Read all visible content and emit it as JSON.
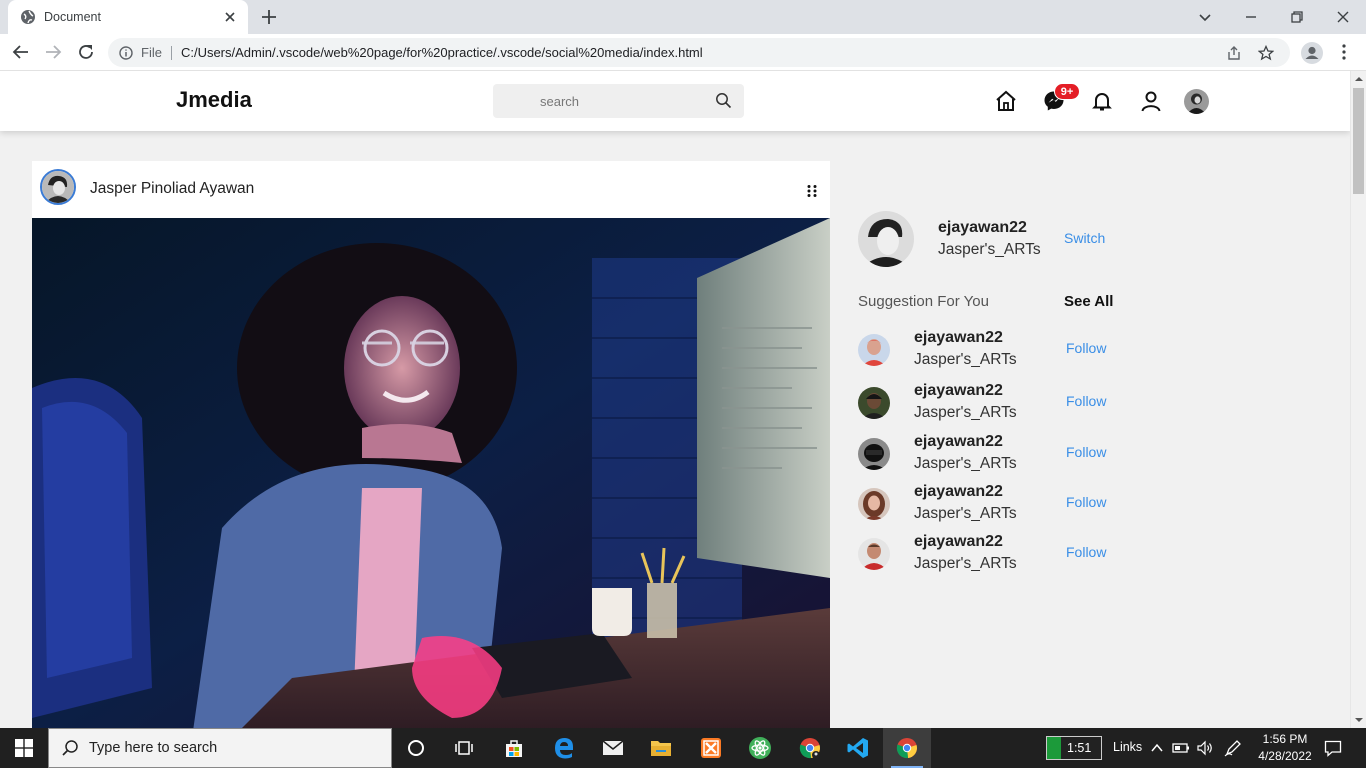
{
  "browser": {
    "tab_title": "Document",
    "url_scheme_label": "File",
    "url": "C:/Users/Admin/.vscode/web%20page/for%20practice/.vscode/social%20media/index.html"
  },
  "app": {
    "logo": "Jmedia",
    "search_placeholder": "search",
    "messages_badge": "9+"
  },
  "post": {
    "author": "Jasper Pinoliad Ayawan"
  },
  "sidebar": {
    "profile": {
      "username": "ejayawan22",
      "subtitle": "Jasper's_ARTs",
      "switch_label": "Switch"
    },
    "suggestion_title": "Suggestion For You",
    "see_all": "See All",
    "suggestions": [
      {
        "username": "ejayawan22",
        "subtitle": "Jasper's_ARTs",
        "follow_label": "Follow"
      },
      {
        "username": "ejayawan22",
        "subtitle": "Jasper's_ARTs",
        "follow_label": "Follow"
      },
      {
        "username": "ejayawan22",
        "subtitle": "Jasper's_ARTs",
        "follow_label": "Follow"
      },
      {
        "username": "ejayawan22",
        "subtitle": "Jasper's_ARTs",
        "follow_label": "Follow"
      },
      {
        "username": "ejayawan22",
        "subtitle": "Jasper's_ARTs",
        "follow_label": "Follow"
      }
    ]
  },
  "taskbar": {
    "search_placeholder": "Type here to search",
    "widget_time": "1:51",
    "links_label": "Links",
    "time": "1:56 PM",
    "date": "4/28/2022"
  },
  "colors": {
    "accent": "#3a8ee6",
    "badge": "#e41e26",
    "taskbar": "#202020"
  }
}
